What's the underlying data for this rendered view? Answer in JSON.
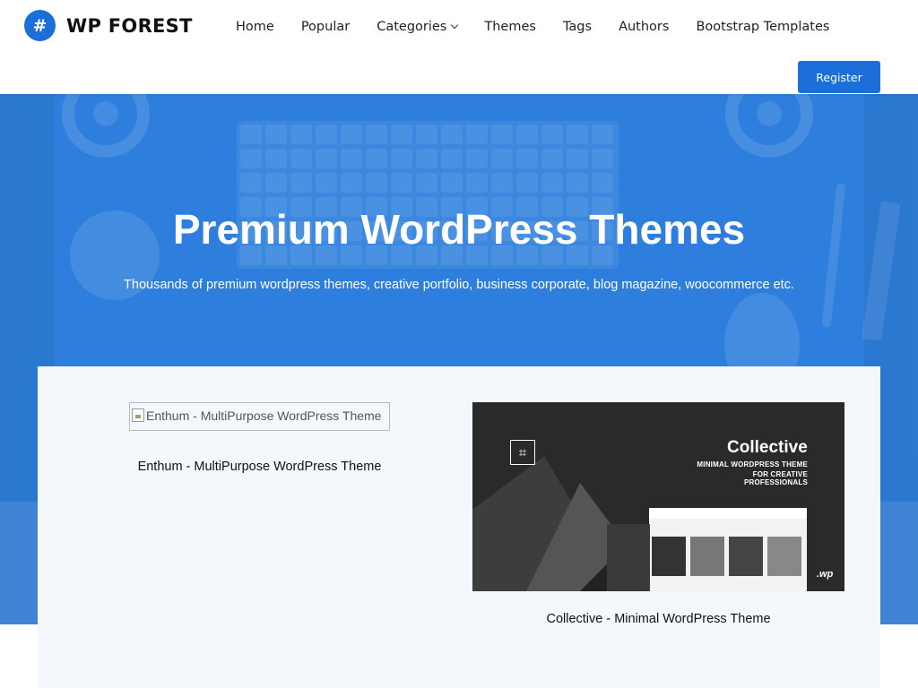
{
  "header": {
    "logo_icon": "#",
    "logo_text": "WP FOREST",
    "nav": [
      {
        "label": "Home"
      },
      {
        "label": "Popular"
      },
      {
        "label": "Categories"
      },
      {
        "label": "Themes"
      },
      {
        "label": "Tags"
      },
      {
        "label": "Authors"
      },
      {
        "label": "Bootstrap Templates"
      }
    ],
    "register_label": "Register"
  },
  "hero": {
    "title": "Premium WordPress Themes",
    "subtitle": "Thousands of premium wordpress themes, creative portfolio, business corporate, blog magazine, woocommerce etc."
  },
  "themes": [
    {
      "image_alt": "Enthum - MultiPurpose WordPress Theme",
      "caption": "Enthum - MultiPurpose WordPress Theme"
    },
    {
      "image_alt": "Collective - Minimal WordPress Theme",
      "caption": "Collective - Minimal WordPress Theme",
      "promo": {
        "title": "Collective",
        "line1": "MINIMAL WORDPRESS THEME",
        "line2": "FOR CREATIVE PROFESSIONALS",
        "mark": "⌗",
        "badge": ".wp"
      }
    }
  ],
  "colors": {
    "accent": "#1c6fd8",
    "hero_bg": "#2e7fdd",
    "panel_bg": "#f4f7fb"
  },
  "icons": {
    "logo": "hash-icon",
    "categories_dropdown": "chevron-down-icon",
    "broken_image": "broken-image-icon"
  }
}
